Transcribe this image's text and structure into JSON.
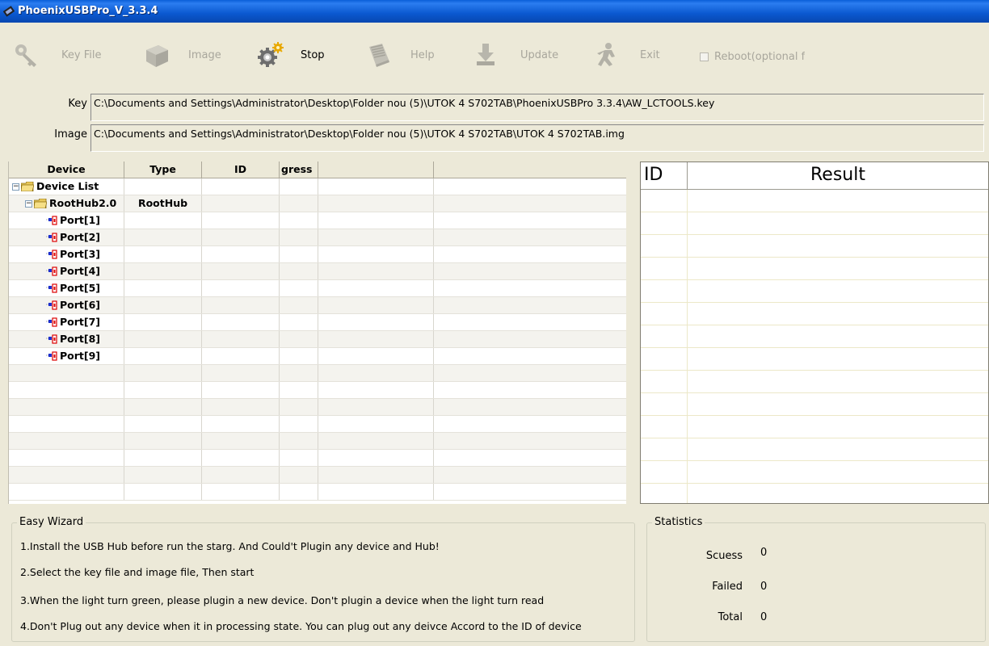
{
  "window": {
    "title": "PhoenixUSBPro_V_3.3.4"
  },
  "toolbar": {
    "key_file": "Key File",
    "image": "Image",
    "stop": "Stop",
    "help": "Help",
    "update": "Update",
    "exit": "Exit",
    "reboot": "Reboot(optional for"
  },
  "paths": {
    "key_label": "Key",
    "key_value": "C:\\Documents and Settings\\Administrator\\Desktop\\Folder nou (5)\\UTOK 4 S702TAB\\PhoenixUSBPro 3.3.4\\AW_LCTOOLS.key",
    "image_label": "Image",
    "image_value": "C:\\Documents and Settings\\Administrator\\Desktop\\Folder nou (5)\\UTOK 4 S702TAB\\UTOK 4 S702TAB.img"
  },
  "device_grid": {
    "columns": [
      "Device",
      "Type",
      "ID",
      "gress",
      "",
      ""
    ],
    "rows": [
      {
        "name": "Device List",
        "type": "",
        "kind": "root"
      },
      {
        "name": "RootHub2.0",
        "type": "RootHub",
        "kind": "hub"
      },
      {
        "name": "Port[1]",
        "type": "",
        "kind": "port"
      },
      {
        "name": "Port[2]",
        "type": "",
        "kind": "port"
      },
      {
        "name": "Port[3]",
        "type": "",
        "kind": "port"
      },
      {
        "name": "Port[4]",
        "type": "",
        "kind": "port"
      },
      {
        "name": "Port[5]",
        "type": "",
        "kind": "port"
      },
      {
        "name": "Port[6]",
        "type": "",
        "kind": "port"
      },
      {
        "name": "Port[7]",
        "type": "",
        "kind": "port"
      },
      {
        "name": "Port[8]",
        "type": "",
        "kind": "port"
      },
      {
        "name": "Port[9]",
        "type": "",
        "kind": "port"
      }
    ]
  },
  "result_panel": {
    "id_header": "ID",
    "result_header": "Result"
  },
  "wizard": {
    "title": "Easy Wizard",
    "lines": [
      "1.Install the USB Hub before run the starg. And Could't Plugin any device and Hub!",
      "2.Select the key file and image file, Then start",
      "3.When the light turn green, please plugin a new device. Don't plugin a device when the light turn read",
      "4.Don't Plug out any device when it in processing state. You can plug out any deivce Accord to the ID of device"
    ]
  },
  "statistics": {
    "title": "Statistics",
    "success_label": "Scuess",
    "success_value": "0",
    "failed_label": "Failed",
    "failed_value": "0",
    "total_label": "Total",
    "total_value": "0"
  },
  "icons": {
    "app": "usb-chip-icon",
    "key_file": "key-icon",
    "image": "box-icon",
    "stop": "gears-icon",
    "help": "book-icon",
    "update": "download-arrow-icon",
    "exit": "running-man-icon"
  }
}
